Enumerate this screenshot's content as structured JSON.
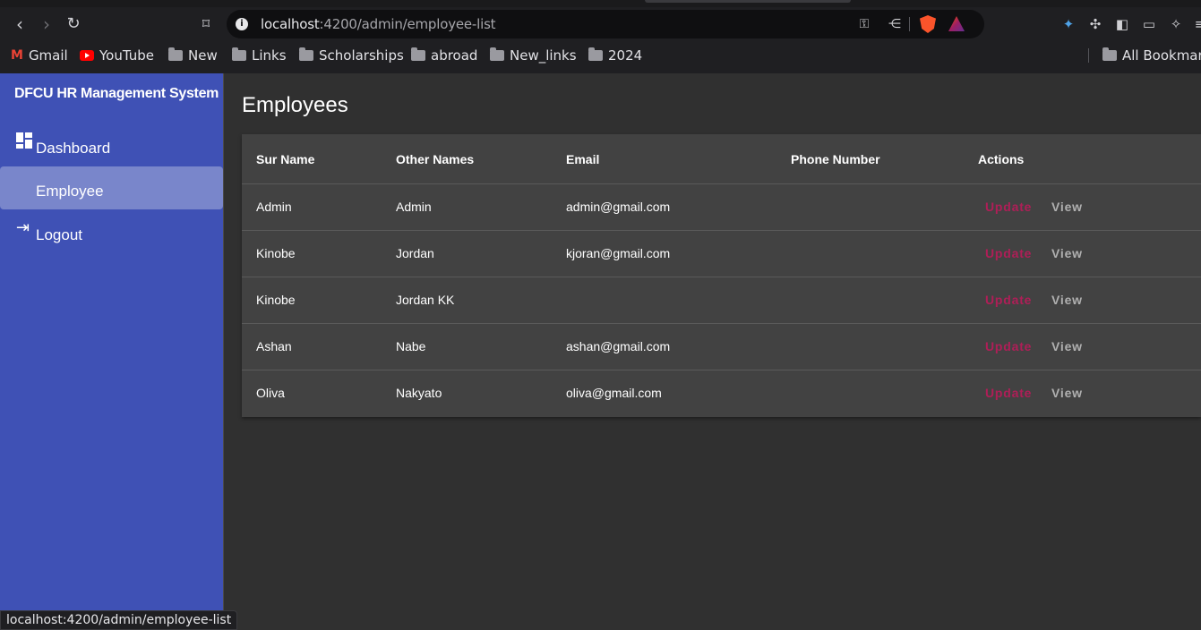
{
  "browser": {
    "url_host": "localhost",
    "url_path": ":4200/admin/employee-list",
    "bookmarks": [
      {
        "label": "Gmail"
      },
      {
        "label": "YouTube"
      },
      {
        "label": "New"
      },
      {
        "label": "Links"
      },
      {
        "label": "Scholarships"
      },
      {
        "label": "abroad"
      },
      {
        "label": "New_links"
      },
      {
        "label": "2024"
      }
    ],
    "all_bookmarks": "All Bookmarks",
    "status_url": "localhost:4200/admin/employee-list"
  },
  "sidebar": {
    "brand": "DFCU HR Management System",
    "items": [
      {
        "label": "Dashboard",
        "icon": "dashboard-icon"
      },
      {
        "label": "Employee",
        "icon": ""
      },
      {
        "label": "Logout",
        "icon": "logout-icon"
      }
    ],
    "active_item": "Employee"
  },
  "main": {
    "title": "Employees",
    "table": {
      "headers": [
        "Sur Name",
        "Other Names",
        "Email",
        "Phone Number",
        "Actions"
      ],
      "rows": [
        {
          "surname": "Admin",
          "other_names": "Admin",
          "email": "admin@gmail.com",
          "phone": ""
        },
        {
          "surname": "Kinobe",
          "other_names": "Jordan",
          "email": "kjoran@gmail.com",
          "phone": ""
        },
        {
          "surname": "Kinobe",
          "other_names": "Jordan KK",
          "email": "",
          "phone": ""
        },
        {
          "surname": "Ashan",
          "other_names": "Nabe",
          "email": "ashan@gmail.com",
          "phone": ""
        },
        {
          "surname": "Oliva",
          "other_names": "Nakyato",
          "email": "oliva@gmail.com",
          "phone": ""
        }
      ],
      "update_label": "Update",
      "view_label": "View"
    }
  },
  "colors": {
    "sidebar_bg": "#3f51b5",
    "sidebar_active": "#7986cb",
    "update_color": "#c2185b",
    "page_bg": "#303030",
    "table_bg": "#424242"
  }
}
